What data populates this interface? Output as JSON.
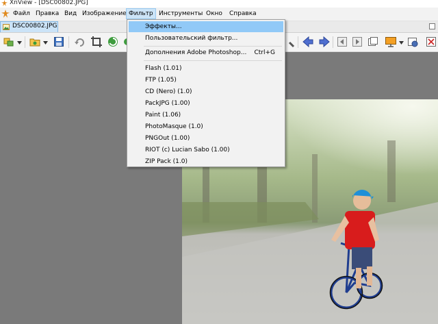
{
  "window": {
    "title": "XnView - [DSC00802.JPG]"
  },
  "menubar": {
    "items": [
      {
        "label": "Файл"
      },
      {
        "label": "Правка"
      },
      {
        "label": "Вид"
      },
      {
        "label": "Изображение"
      },
      {
        "label": "Фильтр",
        "active": true
      },
      {
        "label": "Инструменты"
      },
      {
        "label": "Окно"
      },
      {
        "label": "Справка"
      }
    ]
  },
  "tabs": [
    {
      "label": "DSC00802.JPG",
      "active": true
    }
  ],
  "toolbar": {
    "icons": [
      "browser-icon",
      "open-icon",
      "save-icon",
      "undo-icon",
      "crop-icon",
      "refresh-icon",
      "zoom-icon",
      "prev-icon",
      "next-icon",
      "first-page-icon",
      "prev-page-icon",
      "fullscreen-icon",
      "slideshow-icon",
      "settings-icon",
      "close-icon"
    ]
  },
  "filter_menu": {
    "items": [
      {
        "label": "Эффекты...",
        "highlighted": true
      },
      {
        "label": "Пользовательский фильтр..."
      },
      {
        "separator": true
      },
      {
        "label": "Дополнения Adobe Photoshop...",
        "shortcut": "Ctrl+G"
      },
      {
        "separator": true
      },
      {
        "label": "Flash (1.01)"
      },
      {
        "label": "FTP (1.05)"
      },
      {
        "label": "CD (Nero) (1.0)"
      },
      {
        "label": "PackJPG (1.00)"
      },
      {
        "label": "Paint (1.06)"
      },
      {
        "label": "PhotoMasque (1.0)"
      },
      {
        "label": "PNGOut (1.00)"
      },
      {
        "label": "RIOT (c) Lucian Sabo (1.00)"
      },
      {
        "label": "ZIP Pack (1.0)"
      }
    ]
  },
  "colors": {
    "menu_highlight": "#91c9f7",
    "active_menu": "#cce4f7",
    "viewer_background": "#7a7a7a"
  }
}
